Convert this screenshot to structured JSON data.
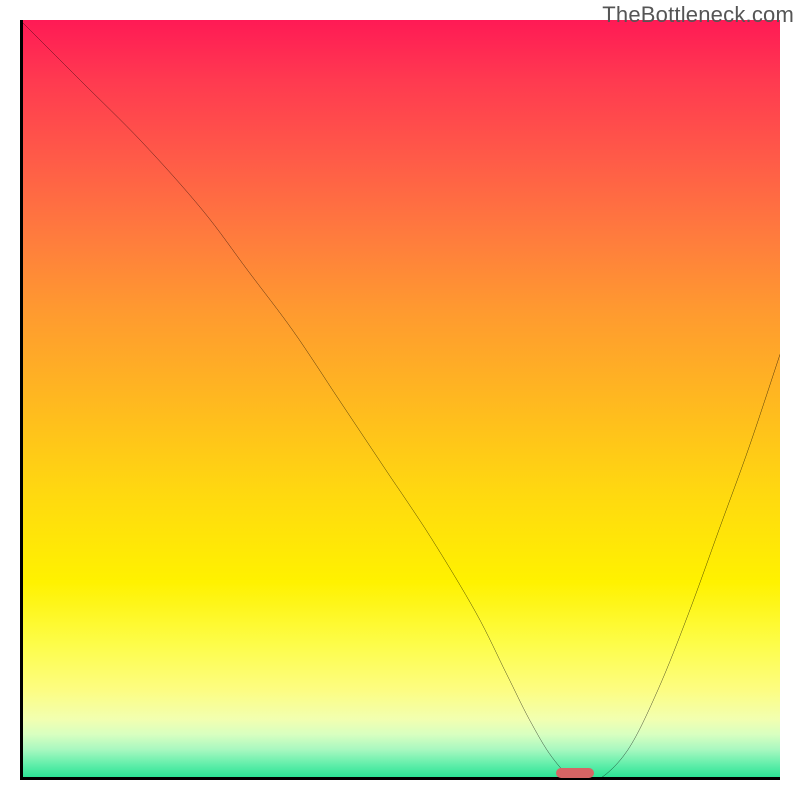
{
  "watermark": "TheBottleneck.com",
  "chart_data": {
    "type": "line",
    "title": "",
    "xlabel": "",
    "ylabel": "",
    "xlim": [
      0,
      100
    ],
    "ylim": [
      0,
      100
    ],
    "grid": false,
    "legend": false,
    "background": {
      "style": "vertical-gradient",
      "stops": [
        {
          "pos": 0,
          "color": "#ff1a55"
        },
        {
          "pos": 50,
          "color": "#ffb820"
        },
        {
          "pos": 80,
          "color": "#fdfd48"
        },
        {
          "pos": 100,
          "color": "#20e090"
        }
      ]
    },
    "series": [
      {
        "name": "bottleneck-curve",
        "color": "#000000",
        "x": [
          0,
          8,
          16,
          24,
          30,
          36,
          42,
          48,
          54,
          60,
          64,
          67,
          70,
          73,
          76,
          80,
          84,
          88,
          92,
          96,
          100
        ],
        "y": [
          100,
          92,
          84,
          75,
          67,
          59,
          50,
          41,
          32,
          22,
          14,
          8,
          3,
          0,
          0,
          4,
          12,
          22,
          33,
          44,
          56
        ]
      }
    ],
    "annotations": [
      {
        "name": "optimal-marker",
        "shape": "pill",
        "color": "#d66565",
        "x": 73,
        "y": 0,
        "width_pct": 5,
        "height_pct": 1.3
      }
    ]
  }
}
